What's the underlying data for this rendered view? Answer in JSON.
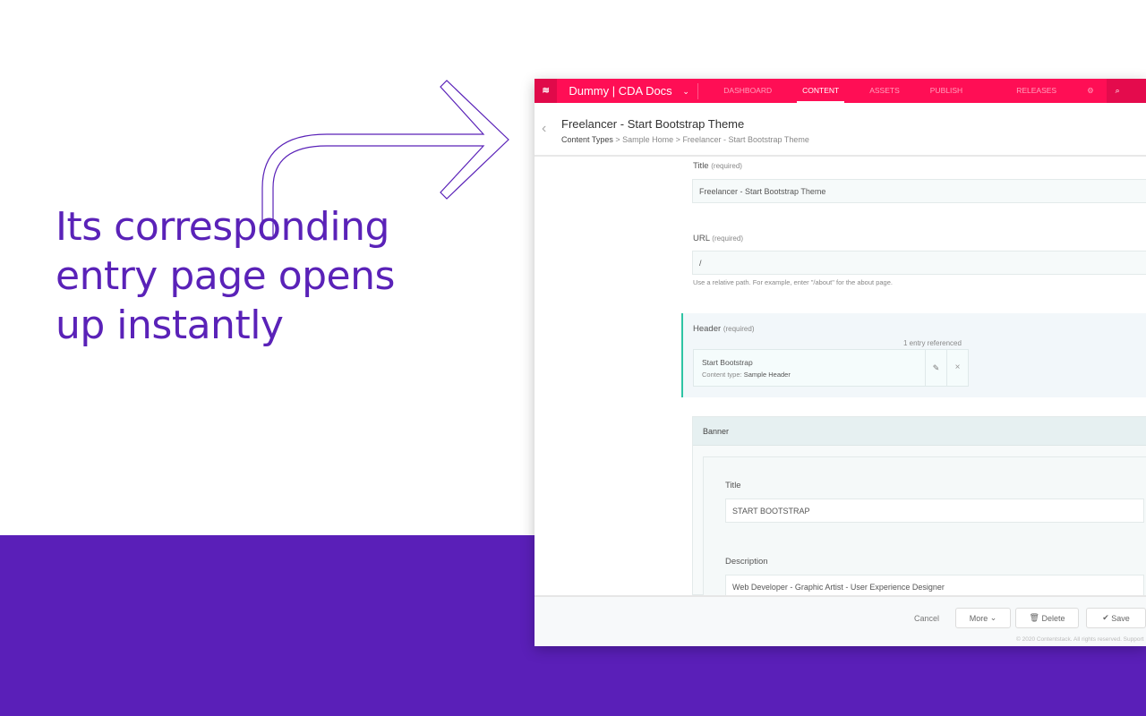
{
  "headline": "Its corresponding entry page opens up instantly",
  "nav": {
    "stack": "Dummy | CDA Docs",
    "tabs": [
      "DASHBOARD",
      "CONTENT",
      "ASSETS",
      "PUBLISH QUEUE",
      "RELEASES"
    ],
    "active": "CONTENT",
    "search": "Search"
  },
  "entry": {
    "title": "Freelancer - Start Bootstrap Theme",
    "breadcrumb": [
      "Content Types",
      "Sample Home",
      "Freelancer - Start Bootstrap Theme"
    ]
  },
  "fields": {
    "title_label": "Title",
    "title_req": "(required)",
    "title_value": "Freelancer - Start Bootstrap Theme",
    "url_label": "URL",
    "url_req": "(required)",
    "url_value": "/",
    "url_hint": "Use a relative path. For example, enter \"/about\" for the about page.",
    "header_label": "Header",
    "header_req": "(required)",
    "ref_count": "1 entry referenced",
    "ref_title": "Start Bootstrap",
    "ref_type_label": "Content type:",
    "ref_type": "Sample Header",
    "banner_label": "Banner",
    "banner_title_label": "Title",
    "banner_title_value": "START BOOTSTRAP",
    "desc_label": "Description",
    "desc_value": "Web Developer - Graphic Artist - User Experience Designer"
  },
  "footer": {
    "cancel": "Cancel",
    "more": "More",
    "delete": "Delete",
    "save": "Save",
    "copyright": "© 2020 Contentstack. All rights reserved. Support"
  },
  "colors": {
    "brand": "#ff0e55",
    "purple": "#5a1fb8"
  }
}
